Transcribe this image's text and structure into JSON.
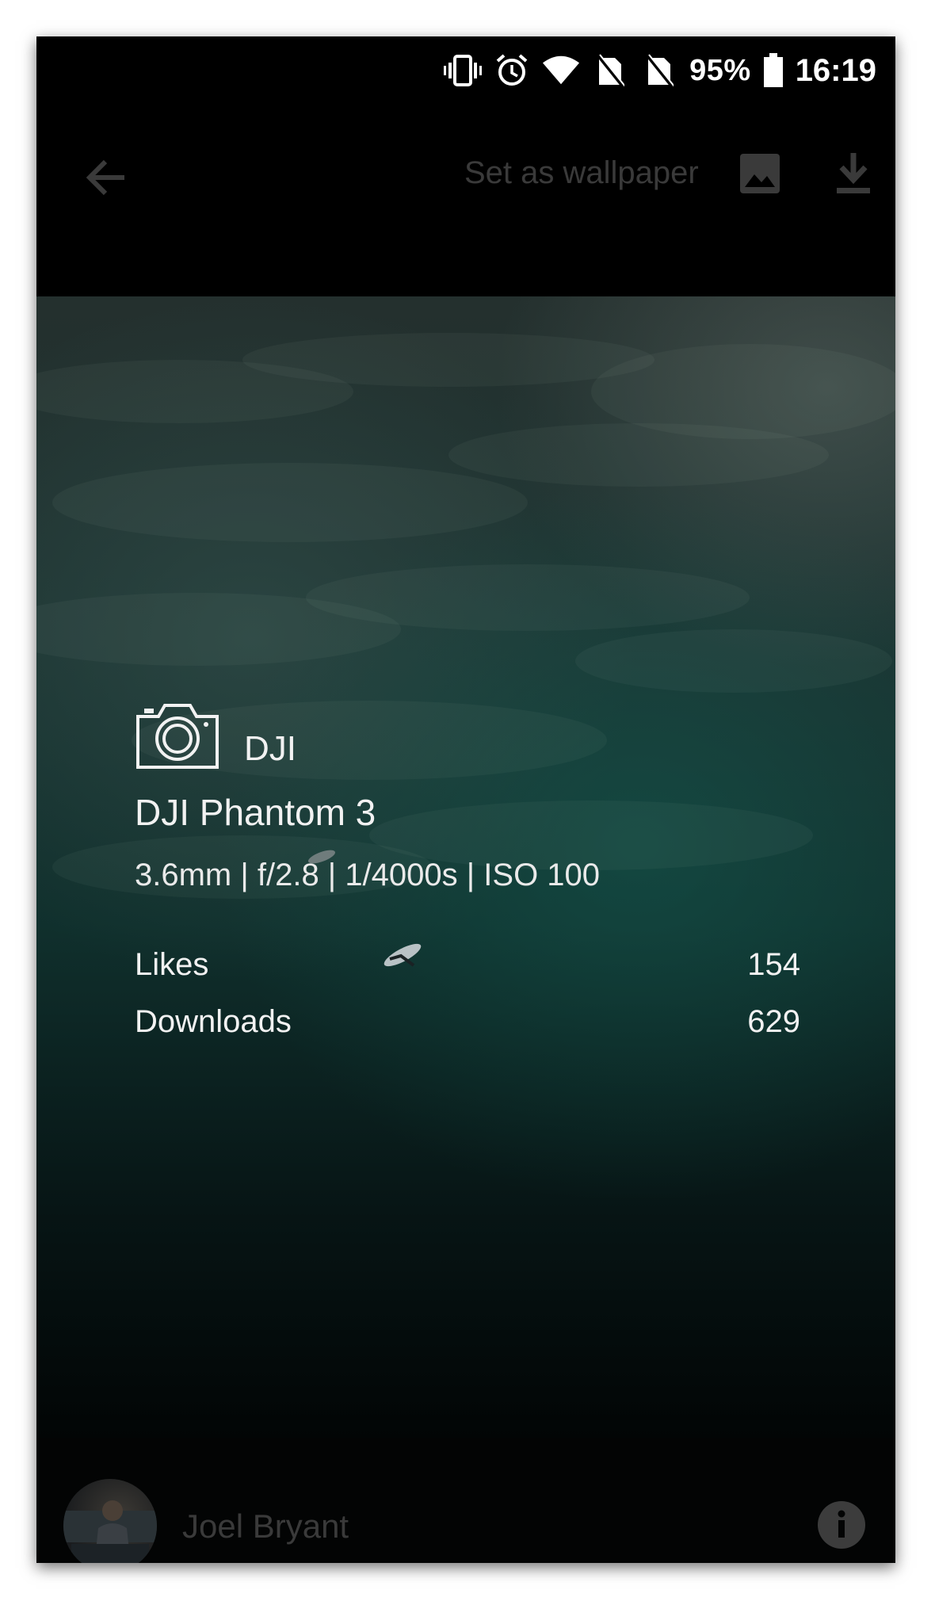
{
  "status_bar": {
    "battery_text": "95%",
    "time": "16:19",
    "icons": [
      "vibrate-icon",
      "alarm-icon",
      "wifi-icon",
      "no-sim-icon",
      "no-sim-icon",
      "battery-icon"
    ]
  },
  "toolbar": {
    "back_icon": "arrow-back-icon",
    "set_wallpaper_label": "Set as wallpaper",
    "wallpaper_icon": "image-icon",
    "download_icon": "download-icon"
  },
  "photo_info": {
    "camera_icon": "camera-icon",
    "make": "DJI",
    "model": "DJI Phantom 3",
    "settings": "3.6mm | f/2.8 | 1/4000s | ISO 100",
    "stats": [
      {
        "label": "Likes",
        "value": "154"
      },
      {
        "label": "Downloads",
        "value": "629"
      }
    ]
  },
  "author": {
    "name": "Joel Bryant",
    "info_icon": "info-icon"
  },
  "colors": {
    "background": "#000000",
    "text_primary": "#f2f2f2",
    "text_dim": "#3a3a3a"
  }
}
